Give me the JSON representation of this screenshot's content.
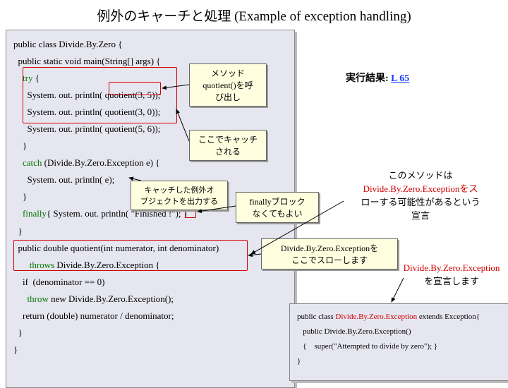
{
  "title": "例外のキャーチと処理 (Example of exception handling)",
  "code": {
    "l1": "public class Divide.By.Zero {",
    "l2": "  public static void main(String[] args) {",
    "l3_kw": "    try",
    "l3_rest": " {",
    "l4": "      System. out. println( quotient(3, 5));",
    "l5": "      System. out. println( quotient(3, 0));",
    "l6": "      System. out. println( quotient(5, 6));",
    "l7": "    }",
    "l8_kw": "    catch",
    "l8_rest": " (Divide.By.Zero.Exception e) {",
    "l9": "      System. out. println( e);",
    "l10": "    }",
    "l11_kw": "    finally",
    "l11_rest": "{ System. out. println( \"Finished !\"); }",
    "l12": "  }",
    "l13": "  public double quotient(int numerator, int denominator)",
    "l14_kw": "       throws",
    "l14_rest": " Divide.By.Zero.Exception {",
    "l15": "    if  (denominator == 0)",
    "l16_kw": "      throw",
    "l16_rest": " new Divide.By.Zero.Exception();",
    "l17": "    return (double) numerator / denominator;",
    "l18": "  }",
    "l19": "}"
  },
  "code2": {
    "l1a": "public class ",
    "l1b": "Divide.By.Zero.Exception",
    "l1c": " extends Exception{",
    "l2": "   public Divide.By.Zero.Exception()",
    "l3": "   {    super(\"Attempted to divide by zero\"); }",
    "l4": "}"
  },
  "callouts": {
    "c1a": "メソッド",
    "c1b": "quotient()を呼",
    "c1c": "び出し",
    "c2a": "ここでキャッチ",
    "c2b": "される",
    "c3a": "キャッチした例外オ",
    "c3b": "ブジェクトを出力する",
    "c4a": "finallyブロック",
    "c4b": "なくてもよい",
    "c5a": "Divide.By.Zero.Exceptionを",
    "c5b": "ここでスローします"
  },
  "result_label": "実行結果:  ",
  "result_link": "L 65",
  "info1a": "このメソッドは",
  "info1b": "Divide.By.Zero.Exceptionをス",
  "info1c": "ローする可能性があるという",
  "info1d": "宣言",
  "info2a": "Divide.By.Zero.Exception",
  "info2b": "を宣言します"
}
